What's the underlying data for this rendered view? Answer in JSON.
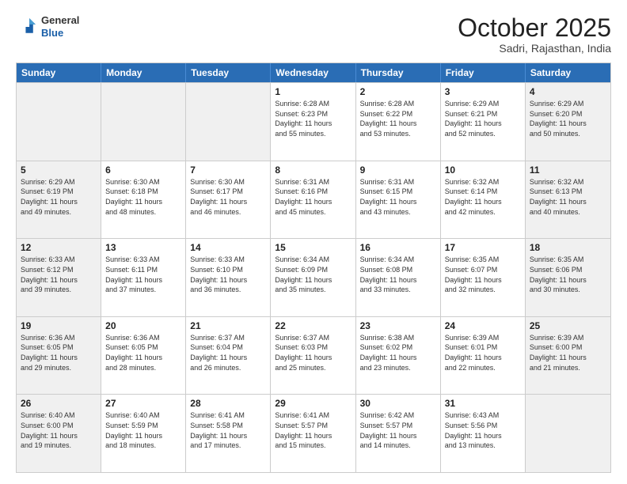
{
  "header": {
    "logo_general": "General",
    "logo_blue": "Blue",
    "month": "October 2025",
    "location": "Sadri, Rajasthan, India"
  },
  "days_of_week": [
    "Sunday",
    "Monday",
    "Tuesday",
    "Wednesday",
    "Thursday",
    "Friday",
    "Saturday"
  ],
  "weeks": [
    [
      {
        "day": "",
        "info": "",
        "shaded": true
      },
      {
        "day": "",
        "info": "",
        "shaded": true
      },
      {
        "day": "",
        "info": "",
        "shaded": true
      },
      {
        "day": "1",
        "info": "Sunrise: 6:28 AM\nSunset: 6:23 PM\nDaylight: 11 hours\nand 55 minutes.",
        "shaded": false
      },
      {
        "day": "2",
        "info": "Sunrise: 6:28 AM\nSunset: 6:22 PM\nDaylight: 11 hours\nand 53 minutes.",
        "shaded": false
      },
      {
        "day": "3",
        "info": "Sunrise: 6:29 AM\nSunset: 6:21 PM\nDaylight: 11 hours\nand 52 minutes.",
        "shaded": false
      },
      {
        "day": "4",
        "info": "Sunrise: 6:29 AM\nSunset: 6:20 PM\nDaylight: 11 hours\nand 50 minutes.",
        "shaded": true
      }
    ],
    [
      {
        "day": "5",
        "info": "Sunrise: 6:29 AM\nSunset: 6:19 PM\nDaylight: 11 hours\nand 49 minutes.",
        "shaded": true
      },
      {
        "day": "6",
        "info": "Sunrise: 6:30 AM\nSunset: 6:18 PM\nDaylight: 11 hours\nand 48 minutes.",
        "shaded": false
      },
      {
        "day": "7",
        "info": "Sunrise: 6:30 AM\nSunset: 6:17 PM\nDaylight: 11 hours\nand 46 minutes.",
        "shaded": false
      },
      {
        "day": "8",
        "info": "Sunrise: 6:31 AM\nSunset: 6:16 PM\nDaylight: 11 hours\nand 45 minutes.",
        "shaded": false
      },
      {
        "day": "9",
        "info": "Sunrise: 6:31 AM\nSunset: 6:15 PM\nDaylight: 11 hours\nand 43 minutes.",
        "shaded": false
      },
      {
        "day": "10",
        "info": "Sunrise: 6:32 AM\nSunset: 6:14 PM\nDaylight: 11 hours\nand 42 minutes.",
        "shaded": false
      },
      {
        "day": "11",
        "info": "Sunrise: 6:32 AM\nSunset: 6:13 PM\nDaylight: 11 hours\nand 40 minutes.",
        "shaded": true
      }
    ],
    [
      {
        "day": "12",
        "info": "Sunrise: 6:33 AM\nSunset: 6:12 PM\nDaylight: 11 hours\nand 39 minutes.",
        "shaded": true
      },
      {
        "day": "13",
        "info": "Sunrise: 6:33 AM\nSunset: 6:11 PM\nDaylight: 11 hours\nand 37 minutes.",
        "shaded": false
      },
      {
        "day": "14",
        "info": "Sunrise: 6:33 AM\nSunset: 6:10 PM\nDaylight: 11 hours\nand 36 minutes.",
        "shaded": false
      },
      {
        "day": "15",
        "info": "Sunrise: 6:34 AM\nSunset: 6:09 PM\nDaylight: 11 hours\nand 35 minutes.",
        "shaded": false
      },
      {
        "day": "16",
        "info": "Sunrise: 6:34 AM\nSunset: 6:08 PM\nDaylight: 11 hours\nand 33 minutes.",
        "shaded": false
      },
      {
        "day": "17",
        "info": "Sunrise: 6:35 AM\nSunset: 6:07 PM\nDaylight: 11 hours\nand 32 minutes.",
        "shaded": false
      },
      {
        "day": "18",
        "info": "Sunrise: 6:35 AM\nSunset: 6:06 PM\nDaylight: 11 hours\nand 30 minutes.",
        "shaded": true
      }
    ],
    [
      {
        "day": "19",
        "info": "Sunrise: 6:36 AM\nSunset: 6:05 PM\nDaylight: 11 hours\nand 29 minutes.",
        "shaded": true
      },
      {
        "day": "20",
        "info": "Sunrise: 6:36 AM\nSunset: 6:05 PM\nDaylight: 11 hours\nand 28 minutes.",
        "shaded": false
      },
      {
        "day": "21",
        "info": "Sunrise: 6:37 AM\nSunset: 6:04 PM\nDaylight: 11 hours\nand 26 minutes.",
        "shaded": false
      },
      {
        "day": "22",
        "info": "Sunrise: 6:37 AM\nSunset: 6:03 PM\nDaylight: 11 hours\nand 25 minutes.",
        "shaded": false
      },
      {
        "day": "23",
        "info": "Sunrise: 6:38 AM\nSunset: 6:02 PM\nDaylight: 11 hours\nand 23 minutes.",
        "shaded": false
      },
      {
        "day": "24",
        "info": "Sunrise: 6:39 AM\nSunset: 6:01 PM\nDaylight: 11 hours\nand 22 minutes.",
        "shaded": false
      },
      {
        "day": "25",
        "info": "Sunrise: 6:39 AM\nSunset: 6:00 PM\nDaylight: 11 hours\nand 21 minutes.",
        "shaded": true
      }
    ],
    [
      {
        "day": "26",
        "info": "Sunrise: 6:40 AM\nSunset: 6:00 PM\nDaylight: 11 hours\nand 19 minutes.",
        "shaded": true
      },
      {
        "day": "27",
        "info": "Sunrise: 6:40 AM\nSunset: 5:59 PM\nDaylight: 11 hours\nand 18 minutes.",
        "shaded": false
      },
      {
        "day": "28",
        "info": "Sunrise: 6:41 AM\nSunset: 5:58 PM\nDaylight: 11 hours\nand 17 minutes.",
        "shaded": false
      },
      {
        "day": "29",
        "info": "Sunrise: 6:41 AM\nSunset: 5:57 PM\nDaylight: 11 hours\nand 15 minutes.",
        "shaded": false
      },
      {
        "day": "30",
        "info": "Sunrise: 6:42 AM\nSunset: 5:57 PM\nDaylight: 11 hours\nand 14 minutes.",
        "shaded": false
      },
      {
        "day": "31",
        "info": "Sunrise: 6:43 AM\nSunset: 5:56 PM\nDaylight: 11 hours\nand 13 minutes.",
        "shaded": false
      },
      {
        "day": "",
        "info": "",
        "shaded": true
      }
    ]
  ]
}
